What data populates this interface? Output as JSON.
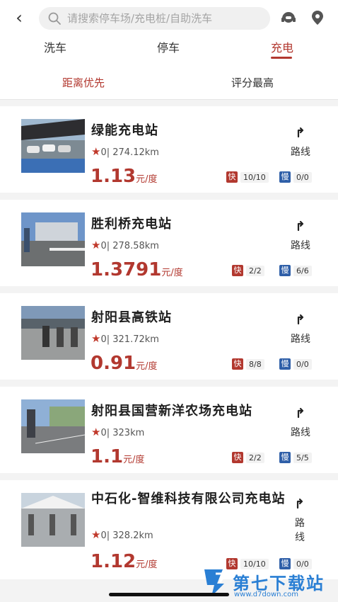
{
  "header": {
    "search_placeholder": "请搜索停车场/充电桩/自助洗车"
  },
  "tabs": [
    {
      "label": "洗车"
    },
    {
      "label": "停车"
    },
    {
      "label": "充电",
      "active": true
    }
  ],
  "sort": [
    {
      "label": "距离优先",
      "active": true
    },
    {
      "label": "评分最高"
    }
  ],
  "stations": [
    {
      "name": "绿能充电站",
      "rating": "0",
      "distance": "274.12km",
      "price": "1.13",
      "unit": "元/度",
      "fast": "10/10",
      "slow": "0/0",
      "route": "路线"
    },
    {
      "name": "胜利桥充电站",
      "rating": "0",
      "distance": "278.58km",
      "price": "1.3791",
      "unit": "元/度",
      "fast": "2/2",
      "slow": "6/6",
      "route": "路线"
    },
    {
      "name": "射阳县高铁站",
      "rating": "0",
      "distance": "321.72km",
      "price": "0.91",
      "unit": "元/度",
      "fast": "8/8",
      "slow": "0/0",
      "route": "路线"
    },
    {
      "name": "射阳县国营新洋农场充电站",
      "rating": "0",
      "distance": "323km",
      "price": "1.1",
      "unit": "元/度",
      "fast": "2/2",
      "slow": "5/5",
      "route": "路线"
    },
    {
      "name": "中石化-智维科技有限公司充电站",
      "rating": "0",
      "distance": "328.2km",
      "price": "1.12",
      "unit": "元/度",
      "fast": "10/10",
      "slow": "0/0",
      "route": "路线"
    }
  ],
  "labels": {
    "fast": "快",
    "slow": "慢",
    "rating_sep": "|",
    "star": "★"
  },
  "watermark": {
    "title": "第七下载站",
    "url": "www.d7down.com"
  },
  "colors": {
    "accent": "#b2382f",
    "slow_badge": "#2f5fa8",
    "watermark": "#2a7fd4"
  }
}
